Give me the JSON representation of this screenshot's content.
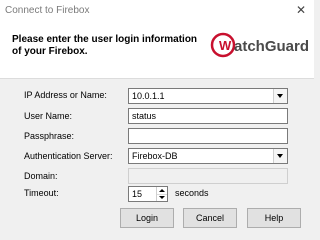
{
  "window": {
    "title": "Connect to Firebox",
    "close_glyph": "✕"
  },
  "header": {
    "prompt": "Please enter the user login information of your Firebox.",
    "logo_text": "WatchGuard",
    "logo_color": "#c8102e"
  },
  "form": {
    "ip": {
      "label": "IP Address or Name:",
      "value": "10.0.1.1"
    },
    "user": {
      "label": "User Name:",
      "value": "status"
    },
    "pass": {
      "label": "Passphrase:",
      "value": ""
    },
    "auth": {
      "label": "Authentication Server:",
      "value": "Firebox-DB"
    },
    "domain": {
      "label": "Domain:",
      "value": ""
    },
    "timeout": {
      "label": "Timeout:",
      "value": "15",
      "unit": "seconds"
    }
  },
  "buttons": {
    "login": "Login",
    "cancel": "Cancel",
    "help": "Help"
  }
}
